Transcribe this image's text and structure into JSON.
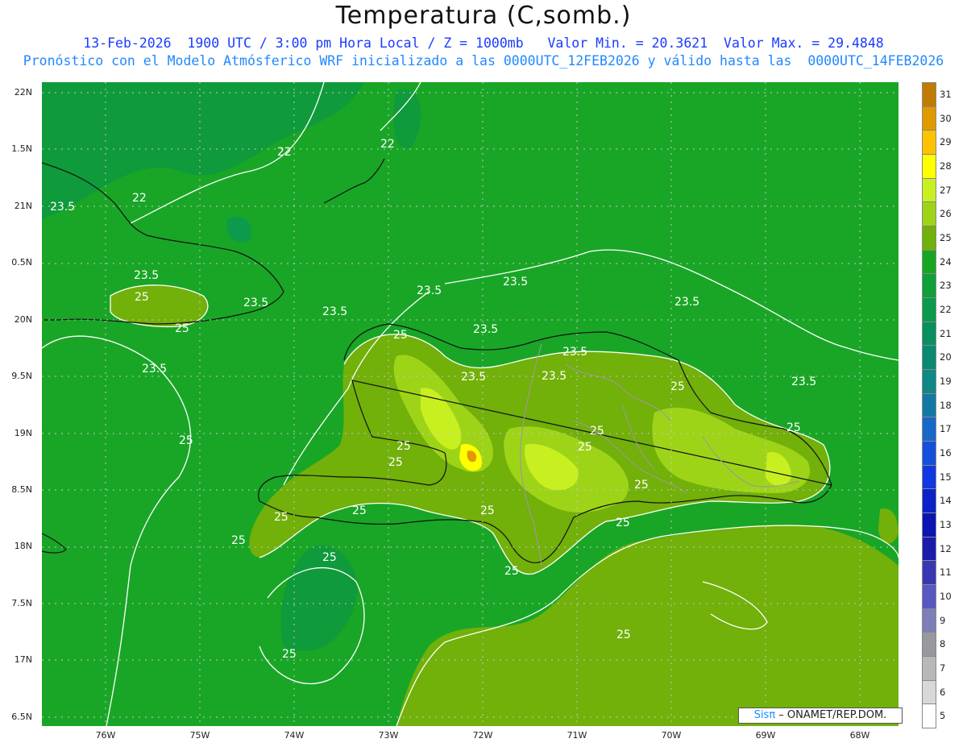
{
  "header": {
    "title": "Temperatura (C,somb.)",
    "subtitle_line1": "13-Feb-2026  1900 UTC / 3:00 pm Hora Local / Z = 1000mb   Valor Min. = 20.3621  Valor Max. = 29.4848",
    "subtitle_line2": "Pronóstico con el Modelo Atmósferico WRF inicializado a las 0000UTC_12FEB2026 y válido hasta las  0000UTC_14FEB2026"
  },
  "axes": {
    "lat_labels": [
      "22N",
      "1.5N",
      "21N",
      "0.5N",
      "20N",
      "9.5N",
      "19N",
      "8.5N",
      "18N",
      "7.5N",
      "17N",
      "6.5N"
    ],
    "lon_labels": [
      "76W",
      "75W",
      "74W",
      "73W",
      "72W",
      "71W",
      "70W",
      "69W",
      "68W"
    ]
  },
  "contour_labels": [
    "22",
    "22",
    "22",
    "23.5",
    "23.5",
    "23.5",
    "23.5",
    "23.5",
    "23.5",
    "23.5",
    "23.5",
    "23.5",
    "23.5",
    "23.5",
    "23.5",
    "23.5",
    "25",
    "25",
    "25",
    "25",
    "25",
    "25",
    "25",
    "25",
    "25",
    "25",
    "25",
    "25",
    "25",
    "25",
    "25",
    "25",
    "25",
    "25",
    "25",
    "25"
  ],
  "colorbar": {
    "levels": [
      "31",
      "30",
      "29",
      "28",
      "27",
      "26",
      "25",
      "24",
      "23",
      "22",
      "21",
      "20",
      "19",
      "18",
      "17",
      "16",
      "15",
      "14",
      "13",
      "12",
      "11",
      "10",
      "9",
      "8",
      "7",
      "6",
      "5"
    ],
    "colors": [
      "#c07c00",
      "#e09a00",
      "#ffc200",
      "#ffff00",
      "#c8f020",
      "#9ed418",
      "#72b00a",
      "#18a622",
      "#0fa03a",
      "#0c9a4c",
      "#099060",
      "#0a8a72",
      "#108886",
      "#1478a4",
      "#1868c8",
      "#1450dc",
      "#1038e0",
      "#0a22c8",
      "#0c14b4",
      "#1c1cac",
      "#3838b4",
      "#5858c0",
      "#7e7eb8",
      "#9898a0",
      "#b8b8b8",
      "#d8d8d8",
      "#ffffff"
    ]
  },
  "credit": {
    "brand": "Sis",
    "pi": "π",
    "rest": " – ONAMET/REP.DOM."
  }
}
